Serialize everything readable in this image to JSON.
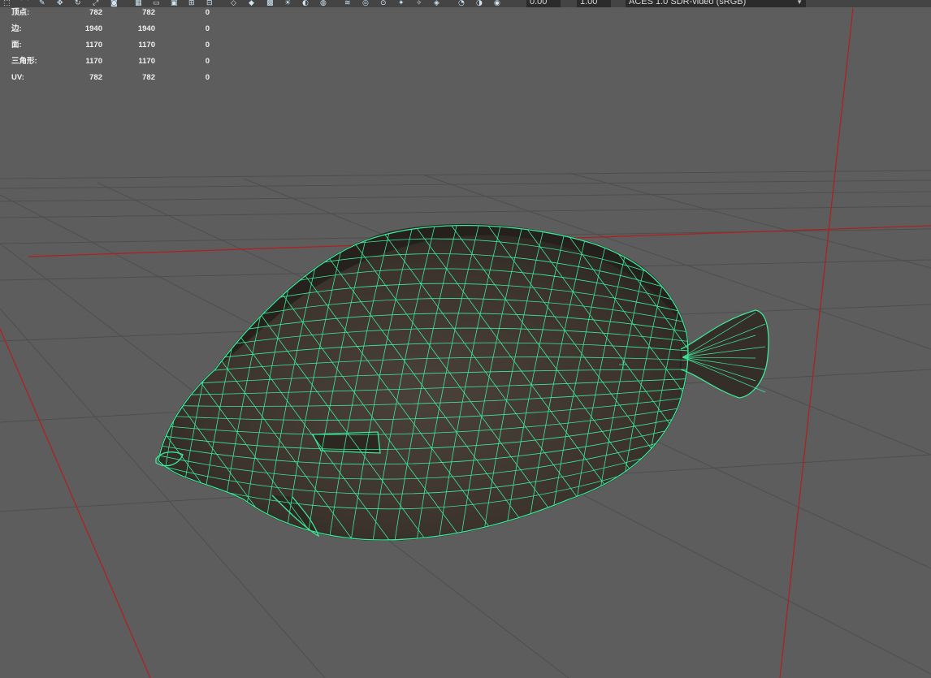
{
  "toolbar": {
    "exposure_value": "0.00",
    "gamma_value": "1.00",
    "color_space": "ACES 1.0 SDR-video (sRGB)",
    "icons": [
      "select-tool-icon",
      "lasso-icon",
      "paint-select-icon",
      "move-icon",
      "rotate-icon",
      "scale-icon",
      "camera-icon",
      "grid-icon",
      "film-gate-icon",
      "resolution-gate-icon",
      "safe-action-icon",
      "safe-title-icon",
      "wireframe-icon",
      "smooth-shade-icon",
      "textured-icon",
      "lights-icon",
      "shadows-icon",
      "ambient-occlusion-icon",
      "antialiasing-icon",
      "depth-of-field-icon",
      "isolate-icon",
      "xray-icon",
      "xray-joints-icon",
      "backface-icon",
      "exposure-icon",
      "gamma-icon",
      "color-management-icon"
    ]
  },
  "hud": {
    "rows": [
      {
        "label": "顶点:",
        "c1": "782",
        "c2": "782",
        "c3": "0"
      },
      {
        "label": "边:",
        "c1": "1940",
        "c2": "1940",
        "c3": "0"
      },
      {
        "label": "面:",
        "c1": "1170",
        "c2": "1170",
        "c3": "0"
      },
      {
        "label": "三角形:",
        "c1": "1170",
        "c2": "1170",
        "c3": "0"
      },
      {
        "label": "UV:",
        "c1": "782",
        "c2": "782",
        "c3": "0"
      }
    ]
  },
  "colors": {
    "viewport_bg": "#5d5d5d",
    "grid_line": "#4a4a4a",
    "axis_red": "#b31e1e",
    "wireframe": "#3ee89a",
    "fish_body": "#3f372f"
  }
}
